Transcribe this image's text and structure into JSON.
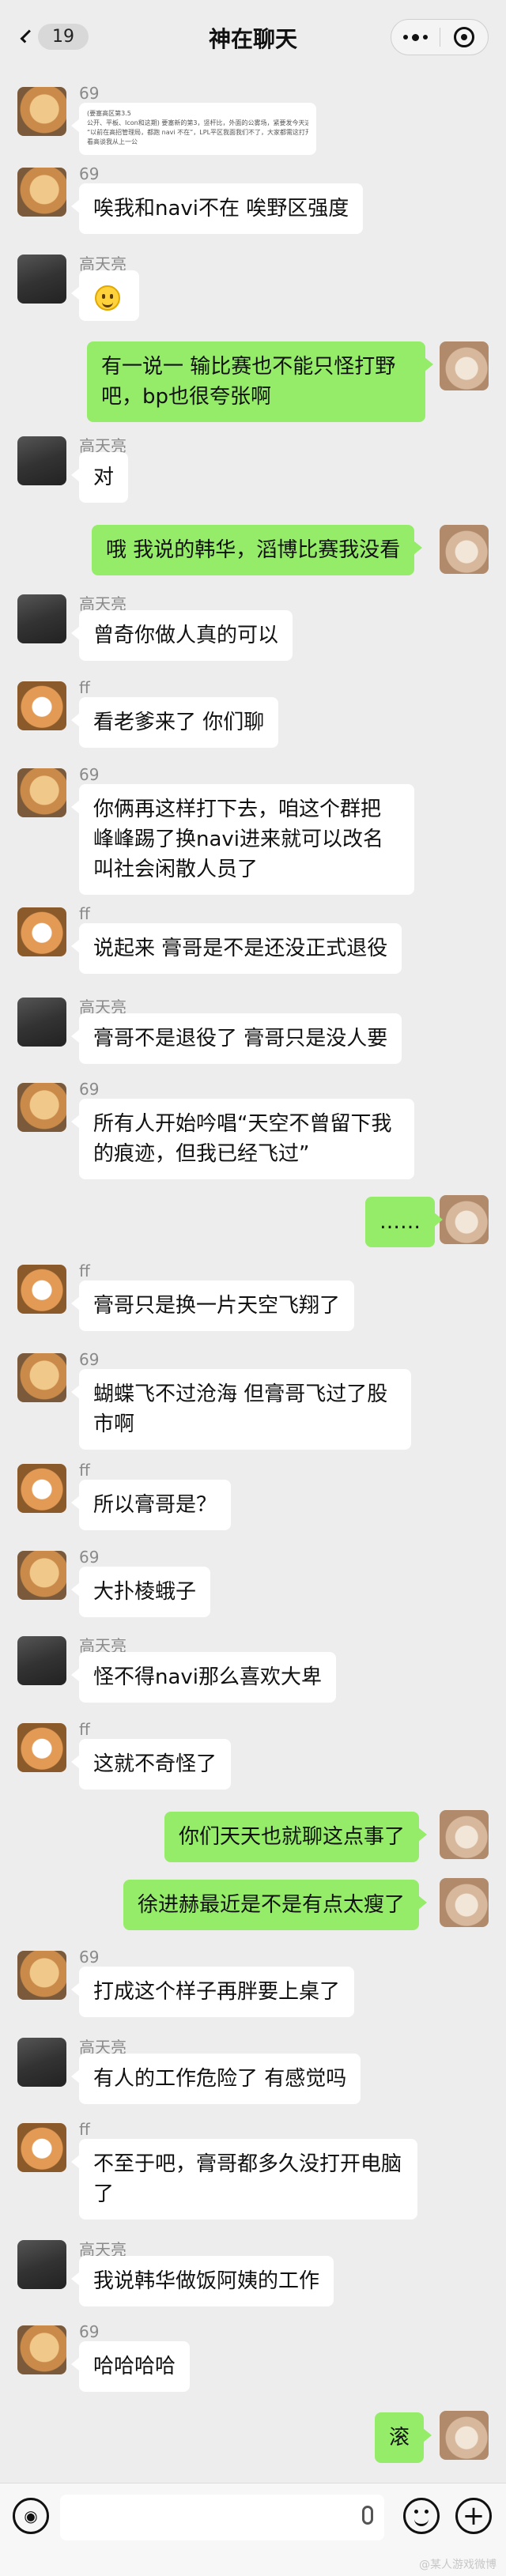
{
  "header": {
    "back_badge": "19",
    "title": "神在聊天"
  },
  "messages": [
    {
      "name": "69",
      "forwarded_lines": [
        "(要塞高区第3.5",
        "公开、平板、Icon和这期) 要塞新的第3，竖杆比，外面的公雾场，紧要发今天这种风在一一天",
        "“以前在高招管理局，都跑 navi 不在”，LPL平区我面我们不了，大家都需这打开去，哪嘛的我的要那顿",
        "看高谈我从上一公"
      ]
    },
    {
      "name": "69",
      "text": "唉我和navi不在 唉野区强度"
    },
    {
      "name": "高天亮",
      "text": ""
    },
    {
      "text": "有一说一 输比赛也不能只怪打野吧，bp也很夸张啊"
    },
    {
      "name": "高天亮",
      "text": "对"
    },
    {
      "text": "哦 我说的韩华，滔博比赛我没看"
    },
    {
      "name": "高天亮",
      "text": "曾奇你做人真的可以"
    },
    {
      "name": "ff",
      "text": "看老爹来了 你们聊"
    },
    {
      "name": "69",
      "text": "你俩再这样打下去，咱这个群把峰峰踢了换navi进来就可以改名叫社会闲散人员了"
    },
    {
      "name": "ff",
      "text": "说起来 膏哥是不是还没正式退役"
    },
    {
      "name": "高天亮",
      "text": "膏哥不是退役了 膏哥只是没人要"
    },
    {
      "name": "69",
      "text": "所有人开始吟唱“天空不曾留下我的痕迹，但我已经飞过”"
    },
    {
      "text": "……"
    },
    {
      "name": "ff",
      "text": "膏哥只是换一片天空飞翔了"
    },
    {
      "name": "69",
      "text": "蝴蝶飞不过沧海 但膏哥飞过了股市啊"
    },
    {
      "name": "ff",
      "text": "所以膏哥是？"
    },
    {
      "name": "69",
      "text": "大扑棱蛾子"
    },
    {
      "name": "高天亮",
      "text": "怪不得navi那么喜欢大卑"
    },
    {
      "name": "ff",
      "text": "这就不奇怪了"
    },
    {
      "text": "你们天天也就聊这点事了"
    },
    {
      "text": "徐进赫最近是不是有点太瘦了"
    },
    {
      "name": "69",
      "text": "打成这个样子再胖要上桌了"
    },
    {
      "name": "高天亮",
      "text": "有人的工作危险了 有感觉吗"
    },
    {
      "name": "ff",
      "text": "不至于吧，膏哥都多久没打开电脑了"
    },
    {
      "name": "高天亮",
      "text": "我说韩华做饭阿姨的工作"
    },
    {
      "name": "69",
      "text": "哈哈哈哈"
    },
    {
      "text": "滚"
    }
  ],
  "watermark": "@某人游戏微博"
}
